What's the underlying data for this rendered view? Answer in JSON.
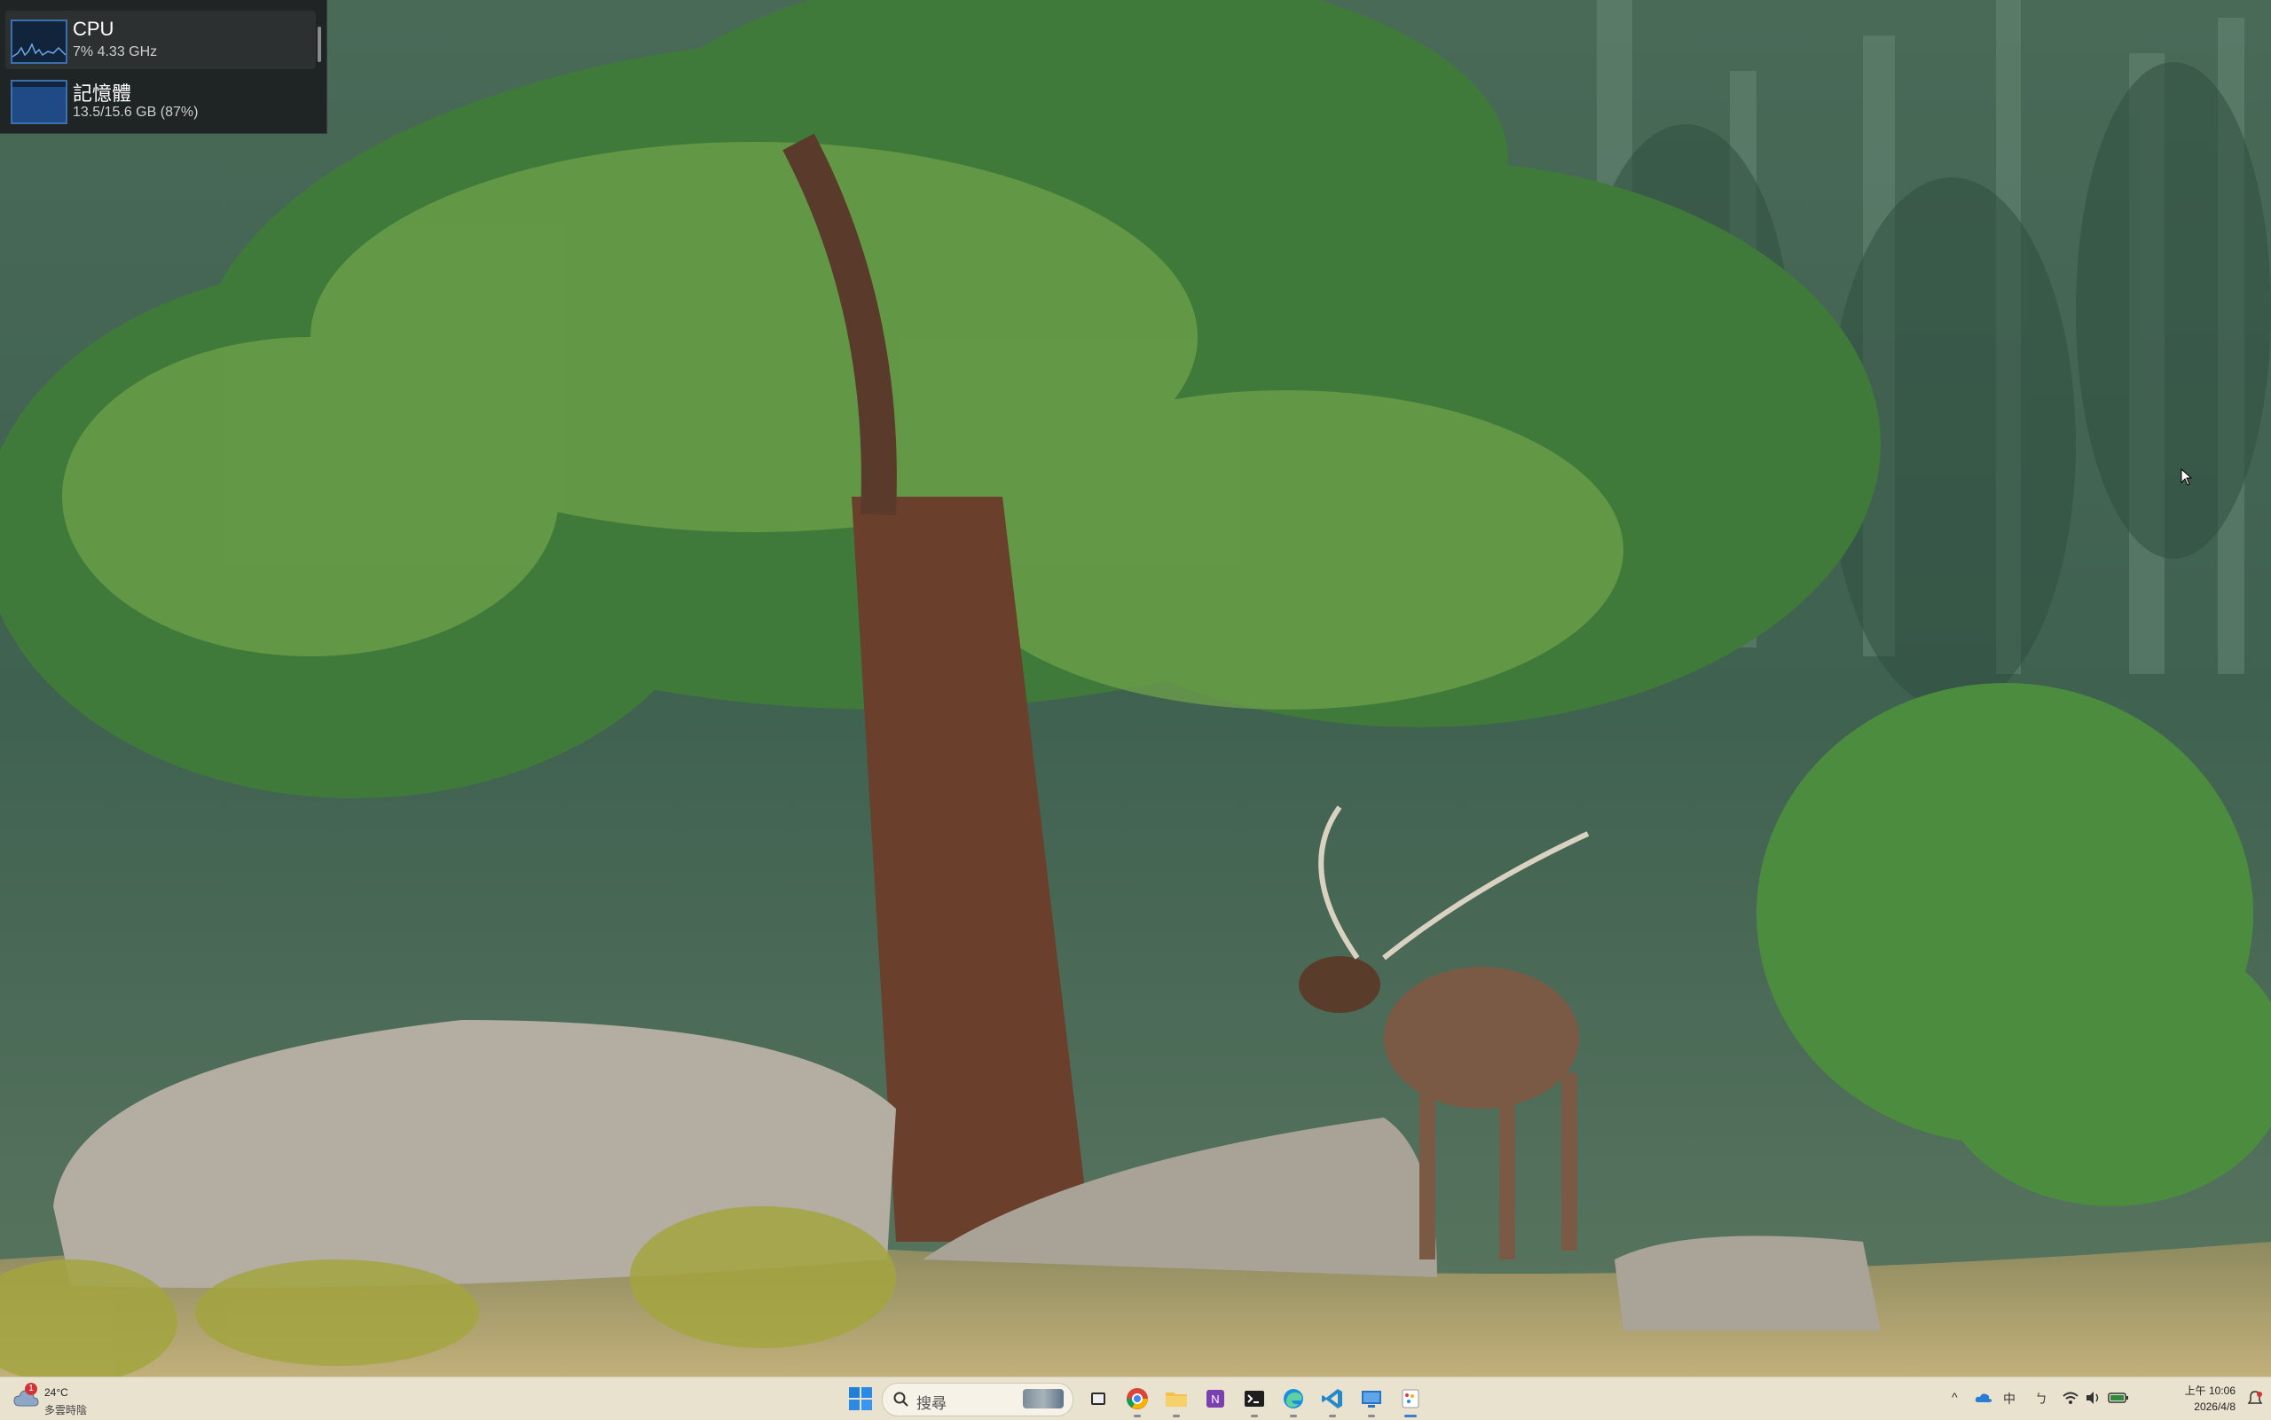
{
  "perf_widget": {
    "cpu": {
      "title": "CPU",
      "detail": "7% 4.33 GHz"
    },
    "memory": {
      "title": "記憶體",
      "detail": "13.5/15.6 GB (87%)"
    }
  },
  "taskbar": {
    "weather": {
      "temp": "24°C",
      "desc": "多雲時陰",
      "badge": "1"
    },
    "search": {
      "placeholder": "搜尋"
    },
    "apps": [
      "task-view",
      "chrome",
      "file-explorer",
      "onenote",
      "terminal",
      "edge",
      "vscode",
      "remote-desktop",
      "paint"
    ],
    "tray": {
      "chevron": "^",
      "ime": "中",
      "ime_mode": "ㄅ",
      "time": "上午 10:06",
      "date": "2026/4/8"
    }
  },
  "colors": {
    "taskbar_bg": "#e9e2cf",
    "widget_bg": "#1c1e20",
    "graph_border": "#3c6fae"
  }
}
